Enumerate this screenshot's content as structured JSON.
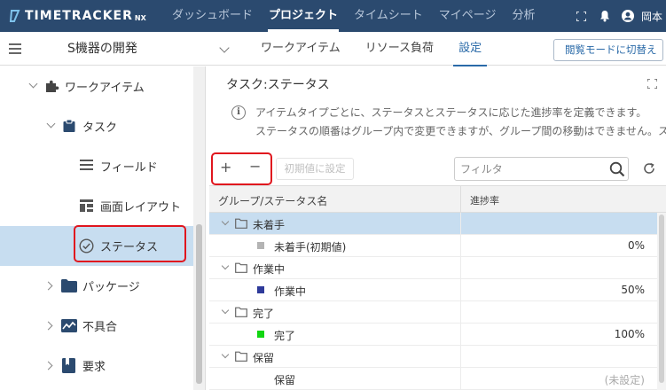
{
  "app": {
    "logo_text": "TIMETRACKER",
    "logo_suffix": "NX"
  },
  "topnav": {
    "items": [
      {
        "label": "ダッシュボード",
        "active": false
      },
      {
        "label": "プロジェクト",
        "active": true
      },
      {
        "label": "タイムシート",
        "active": false
      },
      {
        "label": "マイページ",
        "active": false
      },
      {
        "label": "分析",
        "active": false
      }
    ],
    "user_name": "岡本"
  },
  "subheader": {
    "project_title": "S機器の開発",
    "tabs": [
      {
        "label": "ワークアイテム",
        "active": false
      },
      {
        "label": "リソース負荷",
        "active": false
      },
      {
        "label": "設定",
        "active": true
      }
    ],
    "view_mode_button": "閲覧モードに切替え"
  },
  "sidebar": {
    "items": [
      {
        "label": "ワークアイテム"
      },
      {
        "label": "タスク"
      },
      {
        "label": "フィールド"
      },
      {
        "label": "画面レイアウト"
      },
      {
        "label": "ステータス",
        "selected": true
      },
      {
        "label": "パッケージ"
      },
      {
        "label": "不具合"
      },
      {
        "label": "要求"
      }
    ]
  },
  "panel": {
    "title": "タスク:ステータス",
    "description_line1": "アイテムタイプごとに、ステータスとステータスに応じた進捗率を定義できます。",
    "description_line2": "ステータスの順番はグループ内で変更できますが、グループ間の移動はできません。ス"
  },
  "toolbar": {
    "add": "+",
    "remove": "−",
    "set_default": "初期値に設定",
    "filter_placeholder": "フィルタ"
  },
  "grid": {
    "col_name": "グループ/ステータス名",
    "col_rate": "進捗率",
    "groups": [
      {
        "name": "未着手",
        "status": {
          "name": "未着手(初期値)",
          "rate": "0%",
          "color": "#b4b4b4"
        }
      },
      {
        "name": "作業中",
        "status": {
          "name": "作業中",
          "rate": "50%",
          "color": "#2e3a9a"
        }
      },
      {
        "name": "完了",
        "status": {
          "name": "完了",
          "rate": "100%",
          "color": "#11d611"
        }
      },
      {
        "name": "保留",
        "status": {
          "name": "保留",
          "rate": "(未設定)",
          "color": ""
        }
      }
    ]
  },
  "colors": {
    "nav_bg": "#2b4a6f",
    "accent": "#2a6aa8",
    "selected_bg": "#c7ddf0",
    "highlight_red": "#e0161e"
  }
}
